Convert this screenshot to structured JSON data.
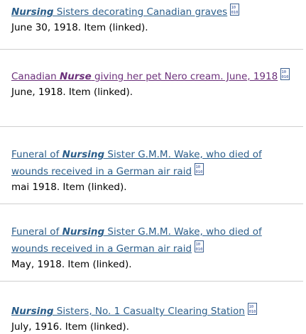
{
  "results": [
    {
      "title_prefix": "",
      "title_bold": "Nursing",
      "title_rest": " Sisters decorating Canadian graves",
      "meta": "June 30, 1918. Item (linked).",
      "icon": "data-file-icon"
    },
    {
      "title_prefix": "Canadian ",
      "title_bold": "Nurse",
      "title_rest": " giving her pet Nero cream. June, 1918",
      "meta": "June, 1918. Item (linked).",
      "icon": "data-file-icon"
    },
    {
      "title_prefix": "Funeral of ",
      "title_bold": "Nursing",
      "title_rest": " Sister G.M.M. Wake, who died of wounds received in a German air raid",
      "meta": "mai 1918. Item (linked).",
      "icon": "data-file-icon"
    },
    {
      "title_prefix": "Funeral of ",
      "title_bold": "Nursing",
      "title_rest": " Sister G.M.M. Wake, who died of wounds received in a German air raid",
      "meta": "May, 1918. Item (linked).",
      "icon": "data-file-icon"
    },
    {
      "title_prefix": "",
      "title_bold": "Nursing",
      "title_rest": " Sisters, No. 1 Casualty Clearing Station",
      "meta": "July, 1916. Item (linked).",
      "icon": "data-file-icon"
    }
  ],
  "colors": {
    "link": "#2a5d8a",
    "visited_link": "#6b2f7a",
    "separator": "#cfcfcf"
  }
}
